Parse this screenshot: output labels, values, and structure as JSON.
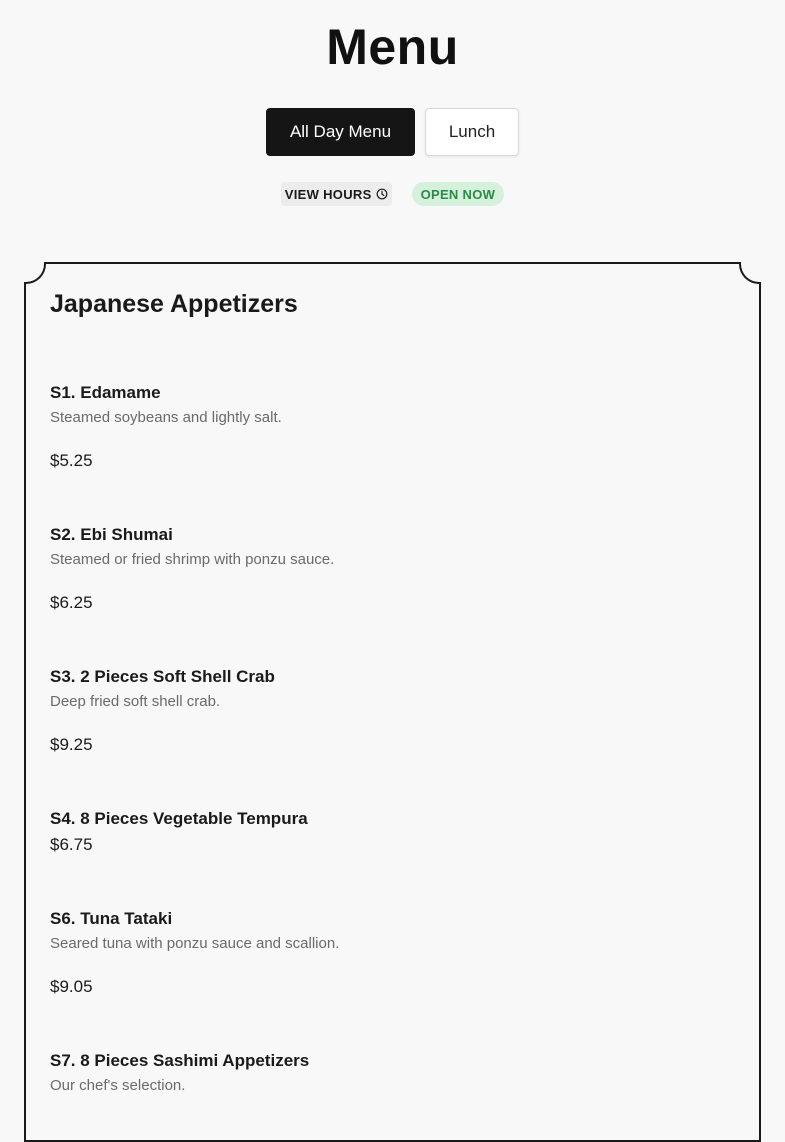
{
  "header": {
    "title": "Menu"
  },
  "tabs": [
    {
      "label": "All Day Menu",
      "active": true
    },
    {
      "label": "Lunch",
      "active": false
    }
  ],
  "status": {
    "view_hours": "VIEW HOURS",
    "open_badge": "OPEN NOW",
    "open_color": "#2b8a48"
  },
  "section": {
    "title": "Japanese Appetizers",
    "items": [
      {
        "name": "S1. Edamame",
        "description": "Steamed soybeans and lightly salt.",
        "price": "$5.25"
      },
      {
        "name": "S2. Ebi Shumai",
        "description": "Steamed or fried shrimp with ponzu sauce.",
        "price": "$6.25"
      },
      {
        "name": "S3. 2 Pieces Soft Shell Crab",
        "description": "Deep fried soft shell crab.",
        "price": "$9.25"
      },
      {
        "name": "S4. 8 Pieces Vegetable Tempura",
        "description": "",
        "price": "$6.75"
      },
      {
        "name": "S6. Tuna Tataki",
        "description": "Seared tuna with ponzu sauce and scallion.",
        "price": "$9.05"
      },
      {
        "name": "S7. 8 Pieces Sashimi Appetizers",
        "description": "Our chef's selection.",
        "price": ""
      }
    ]
  }
}
